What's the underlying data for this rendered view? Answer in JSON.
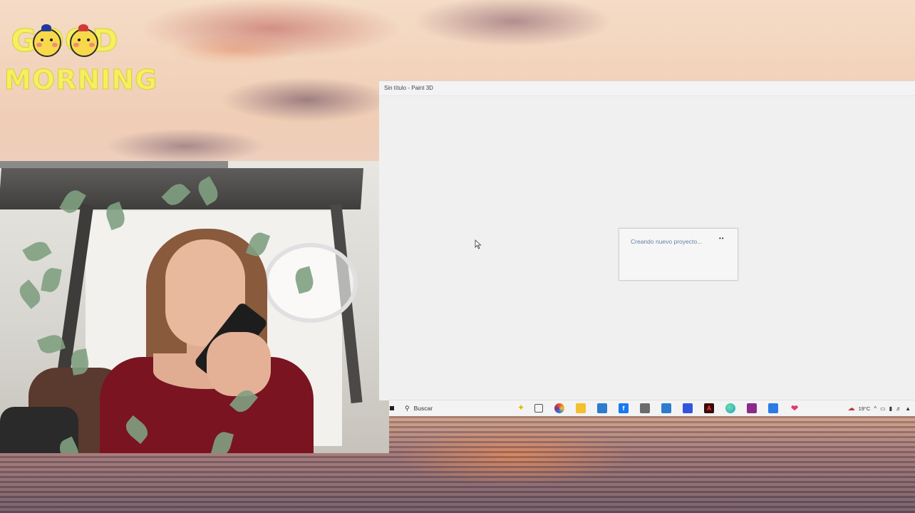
{
  "overlay": {
    "sticker_line1": "GOOD",
    "sticker_line2": "MORNING"
  },
  "paint_window": {
    "title": "Sin título - Paint 3D",
    "loading_dialog": {
      "message": "Creando nuevo proyecto...",
      "spinner": "••"
    }
  },
  "taskbar": {
    "search_placeholder": "Buscar",
    "pinned_apps": [
      {
        "name": "copilot-icon",
        "color": "#e6b400"
      },
      {
        "name": "task-view-icon",
        "color": "#555555"
      },
      {
        "name": "colorful-app-icon",
        "color": "#e8552b"
      },
      {
        "name": "file-explorer-icon",
        "color": "#f2c12e"
      },
      {
        "name": "photos-icon",
        "color": "#2e7bcf"
      },
      {
        "name": "facebook-icon",
        "color": "#1877f2"
      },
      {
        "name": "capture-icon",
        "color": "#6b6b6b"
      },
      {
        "name": "mail-icon",
        "color": "#2e7bcf"
      },
      {
        "name": "app-store-icon",
        "color": "#3355dd"
      },
      {
        "name": "adobe-icon",
        "color": "#3a0a0a"
      },
      {
        "name": "edge-icon",
        "color": "#1e9bd7"
      },
      {
        "name": "winrar-icon",
        "color": "#8b2a8b"
      },
      {
        "name": "paint-icon",
        "color": "#2b7be4"
      },
      {
        "name": "paint3d-icon",
        "color": "#e03a6a"
      }
    ],
    "tray": {
      "temperature": "19°C",
      "chevron": "^"
    }
  }
}
